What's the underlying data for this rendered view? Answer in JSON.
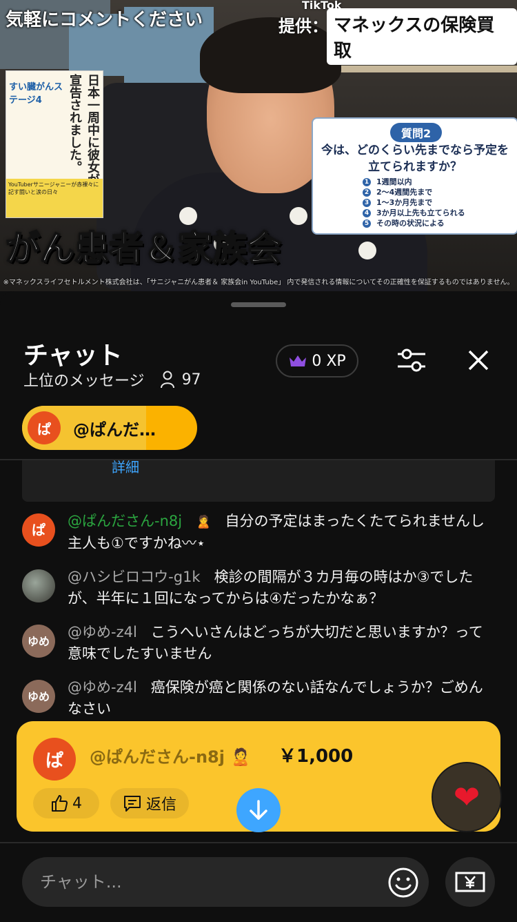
{
  "video": {
    "overlay_text": "気軽にコメントください",
    "sponsor_label": "提供：",
    "sponsor_name": "マネックスの保険買取",
    "tiktok_badge": "TikTok",
    "book": {
      "title": "日本一周中に彼女が余命宣告されました。",
      "subtitle": "すい臓がんステージ4",
      "footer": "YouTuberサニージャニーが赤裸々に記す闘いと涙の日々"
    },
    "question": {
      "label": "質問2",
      "text": "今は、どのくらい先までなら予定を立てられますか？",
      "options": [
        {
          "num": "1",
          "text": "1週間以内"
        },
        {
          "num": "2",
          "text": "2〜4週間先まで"
        },
        {
          "num": "3",
          "text": "1〜3か月先まで"
        },
        {
          "num": "4",
          "text": "3か月以上先も立てられる"
        },
        {
          "num": "5",
          "text": "その時の状況による"
        }
      ]
    },
    "caption": "がん患者＆家族会",
    "disclaimer": "※マネックスライフセトルメント株式会社は、「サニジャニがん患者＆ 家族会in YouTube」 内で発信される情報についてその正確性を保証するものではありません。"
  },
  "chat": {
    "title": "チャット",
    "subtitle": "上位のメッセージ",
    "viewers": "97",
    "xp": "0 XP",
    "pinned": {
      "avatar": "ぱ",
      "name": "@ぱんだ…"
    },
    "details_link": "詳細",
    "messages": [
      {
        "avatar": "ぱ",
        "author": "@ぱんださん-n8j",
        "text": "自分の予定はまったくたてられませんし主人も①ですかね〰⋆"
      },
      {
        "avatar": "",
        "author": "@ハシビロコウ-g1k",
        "text": "検診の間隔が３カ月毎の時はか③でしたが、半年に１回になってからは④だったかなぁ？"
      },
      {
        "avatar": "ゆめ",
        "author": "@ゆめ-z4l",
        "text": "こうへいさんはどっちが大切だと思いますか？って意味でしたすいません"
      },
      {
        "avatar": "ゆめ",
        "author": "@ゆめ-z4l",
        "text": "癌保険が癌と関係のない話なんでしょうか？ごめんなさい"
      }
    ],
    "super_chat": {
      "avatar": "ぱ",
      "author": "@ぱんださん-n8j",
      "amount": "￥1,000",
      "likes": "4",
      "reply_label": "返信"
    },
    "input_placeholder": "チャット...",
    "colors": {
      "accent_blue": "#3ea6ff",
      "super_chat_yellow": "#fbc52c",
      "author_green": "#2ba640",
      "pinned_orange": "#fbb200"
    }
  }
}
